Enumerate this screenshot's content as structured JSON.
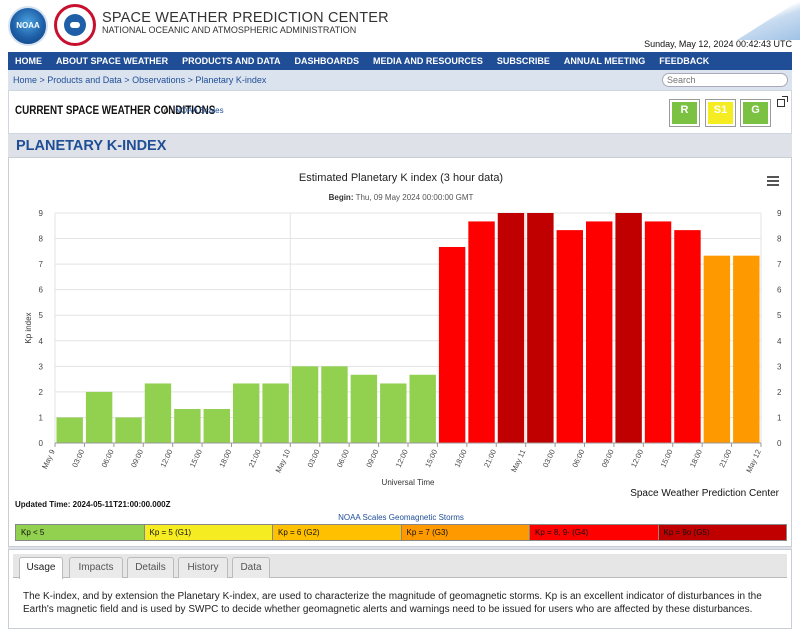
{
  "header": {
    "title": "SPACE WEATHER PREDICTION CENTER",
    "subtitle": "NATIONAL OCEANIC AND ATMOSPHERIC ADMINISTRATION",
    "noaa_logo_text": "NOAA",
    "nws_logo_text": "NATIONAL WEATHER SERVICE",
    "datetime": "Sunday, May 12, 2024 00:42:43 UTC"
  },
  "nav": {
    "items": [
      "HOME",
      "ABOUT SPACE WEATHER",
      "PRODUCTS AND DATA",
      "DASHBOARDS",
      "MEDIA AND RESOURCES",
      "SUBSCRIBE",
      "ANNUAL MEETING",
      "FEEDBACK"
    ]
  },
  "breadcrumb": "Home > Products and Data > Observations > Planetary K-index",
  "search": {
    "placeholder": "Search"
  },
  "conditions": {
    "title": "CURRENT SPACE WEATHER CONDITIONS",
    "on_text": "on",
    "link": "NOAA Scales",
    "scales": [
      {
        "label": "R",
        "color": "#7cc242",
        "bar": "#7cc242",
        "text_color": "#ffffff"
      },
      {
        "label": "S1",
        "color": "#f5ec21",
        "bar": "#f5ec21",
        "text_color": "#ffffff"
      },
      {
        "label": "G",
        "color": "#7cc242",
        "bar": "#7cc242",
        "text_color": "#ffffff"
      }
    ]
  },
  "page_title": "PLANETARY K-INDEX",
  "chart_data": {
    "type": "bar",
    "title": "Estimated Planetary K index (3 hour data)",
    "begin_label": "Begin:",
    "begin_value": "Thu, 09 May 2024 00:00:00 GMT",
    "xlabel": "Universal Time",
    "ylabel": "Kp index",
    "ylim": [
      0,
      9
    ],
    "yticks": [
      0,
      1,
      2,
      3,
      4,
      5,
      6,
      7,
      8,
      9
    ],
    "xtick_labels": [
      "May 9",
      "03:00",
      "06:00",
      "09:00",
      "12:00",
      "15:00",
      "18:00",
      "21:00",
      "May 10",
      "03:00",
      "06:00",
      "09:00",
      "12:00",
      "15:00",
      "18:00",
      "21:00",
      "May 11",
      "03:00",
      "06:00",
      "09:00",
      "12:00",
      "15:00",
      "18:00",
      "21:00",
      "May 12"
    ],
    "values": [
      1.0,
      2.0,
      1.0,
      2.33,
      1.33,
      1.33,
      2.33,
      2.33,
      3.0,
      3.0,
      2.67,
      2.33,
      2.67,
      7.67,
      8.67,
      9.0,
      9.0,
      8.33,
      8.67,
      9.0,
      8.67,
      8.33,
      7.33,
      7.33
    ],
    "grid": true,
    "color_scale": [
      {
        "max": 5,
        "color": "#92d050"
      },
      {
        "max": 7,
        "color": "#ff0000"
      },
      {
        "max": 8,
        "color": "#ff0000"
      },
      {
        "max": 9,
        "color": "#c00000"
      }
    ],
    "g3_color": "#ff9900",
    "credit": "Space Weather Prediction Center",
    "updated": "Updated Time: 2024-05-11T21:00:00.000Z"
  },
  "legend": {
    "caption": "NOAA Scales Geomagnetic Storms",
    "cells": [
      {
        "label": "Kp < 5",
        "color": "#92d050"
      },
      {
        "label": "Kp = 5 (G1)",
        "color": "#f5ec21"
      },
      {
        "label": "Kp = 6 (G2)",
        "color": "#ffc000"
      },
      {
        "label": "Kp = 7 (G3)",
        "color": "#ff9900"
      },
      {
        "label": "Kp = 8, 9- (G4)",
        "color": "#ff0000"
      },
      {
        "label": "Kp = 9o (G5)",
        "color": "#c00000"
      }
    ]
  },
  "tabs": {
    "items": [
      "Usage",
      "Impacts",
      "Details",
      "History",
      "Data"
    ],
    "active": "Usage",
    "usage_text": "The K-index, and by extension the Planetary K-index, are used to characterize the magnitude of geomagnetic storms. Kp is an excellent indicator of disturbances in the Earth's magnetic field and is used by SWPC to decide whether geomagnetic alerts and warnings need to be issued for users who are affected by these disturbances."
  }
}
